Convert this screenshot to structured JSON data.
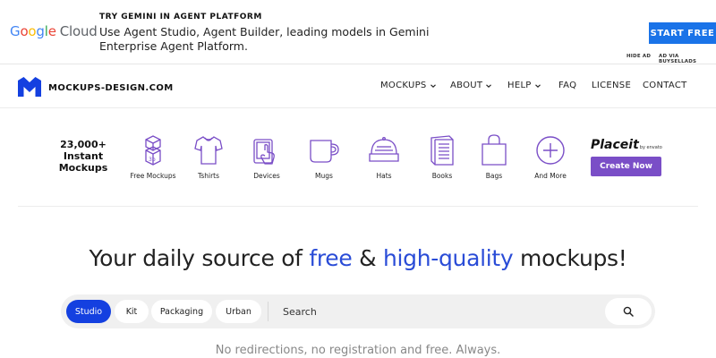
{
  "ad": {
    "logo_letters": [
      "G",
      "o",
      "o",
      "g",
      "l",
      "e"
    ],
    "logo_cloud": "Cloud",
    "headline": "TRY GEMINI IN AGENT PLATFORM",
    "body": "Use Agent Studio, Agent Builder, leading models in Gemini Enterprise Agent Platform.",
    "cta": "START FREE",
    "hide": "HIDE AD",
    "via": "AD VIA BUYSELLADS"
  },
  "nav": {
    "brand": "MOCKUPS-DESIGN.COM",
    "items": [
      {
        "label": "MOCKUPS",
        "dropdown": true
      },
      {
        "label": "ABOUT",
        "dropdown": true
      },
      {
        "label": "HELP",
        "dropdown": true
      },
      {
        "label": "FAQ",
        "dropdown": false
      },
      {
        "label": "LICENSE",
        "dropdown": false
      },
      {
        "label": "CONTACT",
        "dropdown": false
      }
    ]
  },
  "categories": {
    "instant_line1": "23,000+",
    "instant_line2": "Instant",
    "instant_line3": "Mockups",
    "items": [
      {
        "label": "Free Mockups",
        "icon": "box-3d-icon"
      },
      {
        "label": "Tshirts",
        "icon": "tshirt-icon"
      },
      {
        "label": "Devices",
        "icon": "devices-icon"
      },
      {
        "label": "Mugs",
        "icon": "mug-icon"
      },
      {
        "label": "Hats",
        "icon": "hat-icon"
      },
      {
        "label": "Books",
        "icon": "book-icon"
      },
      {
        "label": "Bags",
        "icon": "bag-icon"
      },
      {
        "label": "And More",
        "icon": "plus-circle-icon"
      }
    ],
    "icon_color": "#7a4ec7",
    "placeit_brand": "Placeit",
    "placeit_by": "by envato",
    "create_now": "Create Now"
  },
  "hero": {
    "part1": "Your daily source of ",
    "free": "free",
    "part2": " & ",
    "high_quality": "high-quality",
    "part3": " mockups!",
    "accent_color": "#2a4cd7"
  },
  "search": {
    "tags": [
      {
        "label": "Studio",
        "active": true
      },
      {
        "label": "Kit",
        "active": false
      },
      {
        "label": "Packaging",
        "active": false
      },
      {
        "label": "Urban",
        "active": false
      }
    ],
    "placeholder": "Search",
    "active_color": "#1440e0"
  },
  "tagline": "No redirections, no registration and free. Always."
}
